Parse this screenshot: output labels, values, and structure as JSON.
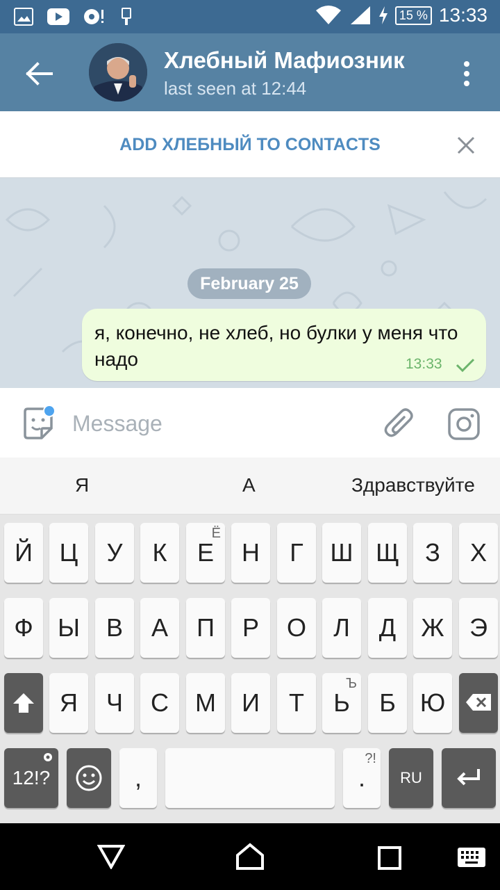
{
  "status_bar": {
    "battery": "15 %",
    "time": "13:33"
  },
  "header": {
    "title": "Хлебный Мафиозник",
    "subtitle": "last seen at 12:44"
  },
  "add_contact": {
    "label": "ADD ХЛЕБНЫЙ TO CONTACTS"
  },
  "chat": {
    "date": "February 25",
    "messages": [
      {
        "text": "я, конечно, не хлеб, но булки у меня что надо",
        "time": "13:33"
      }
    ]
  },
  "composer": {
    "placeholder": "Message"
  },
  "suggestions": [
    "Я",
    "А",
    "Здравствуйте"
  ],
  "keyboard": {
    "row1": [
      "Й",
      "Ц",
      "У",
      "К",
      "Е",
      "Н",
      "Г",
      "Ш",
      "Щ",
      "З",
      "Х"
    ],
    "row1_sub": {
      "Е": "Ё"
    },
    "row2": [
      "Ф",
      "Ы",
      "В",
      "А",
      "П",
      "Р",
      "О",
      "Л",
      "Д",
      "Ж",
      "Э"
    ],
    "row3": [
      "Я",
      "Ч",
      "С",
      "М",
      "И",
      "Т",
      "Ь",
      "Б",
      "Ю"
    ],
    "row3_sub": {
      "Ь": "Ъ"
    },
    "symbols_label": "12!?",
    "comma": ",",
    "period": ".",
    "period_sub": "?!",
    "lang": "RU"
  },
  "icons": {
    "back": "arrow-left-icon",
    "menu": "more-vert-icon",
    "close": "close-icon",
    "emoji": "sticker-icon",
    "attach": "paperclip-icon",
    "camera": "camera-icon"
  },
  "colors": {
    "header": "#5682a3",
    "statusbar": "#3d6a92",
    "accent": "#4e8bc0",
    "bubble": "#effdde",
    "check": "#6bb46b"
  }
}
